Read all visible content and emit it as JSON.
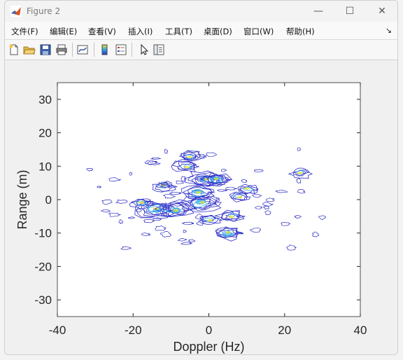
{
  "window": {
    "title": "Figure 2"
  },
  "window_controls": {
    "minimize": "—",
    "maximize": "☐",
    "close": "✕"
  },
  "menu": {
    "items": [
      {
        "label": "文件(F)"
      },
      {
        "label": "编辑(E)"
      },
      {
        "label": "查看(V)"
      },
      {
        "label": "插入(I)"
      },
      {
        "label": "工具(T)"
      },
      {
        "label": "桌面(D)"
      },
      {
        "label": "窗口(W)"
      },
      {
        "label": "帮助(H)"
      }
    ],
    "overflow_icon": "arrow-icon"
  },
  "toolbar": {
    "buttons": [
      "new-figure-icon",
      "open-file-icon",
      "save-icon",
      "print-icon",
      "link-plot-icon",
      "colorbar-icon",
      "legend-icon",
      "pointer-icon",
      "property-inspector-icon"
    ]
  },
  "chart_data": {
    "type": "contour",
    "xlabel": "Doppler (Hz)",
    "ylabel": "Range (m)",
    "xlim": [
      -40,
      40
    ],
    "ylim": [
      -35,
      35
    ],
    "xticks": [
      "-40",
      "-20",
      "0",
      "20",
      "40"
    ],
    "yticks": [
      "30",
      "20",
      "10",
      "0",
      "-10",
      "-20",
      "-30"
    ],
    "colormap": [
      "#3030c8",
      "#2aa7e8",
      "#f0e030"
    ],
    "peaks": [
      {
        "x": -14,
        "y": -3,
        "level": 0.95
      },
      {
        "x": -9,
        "y": -3,
        "level": 0.85
      },
      {
        "x": -2,
        "y": -1,
        "level": 0.9
      },
      {
        "x": -1,
        "y": 6,
        "level": 0.8
      },
      {
        "x": -3,
        "y": 2,
        "level": 0.7
      },
      {
        "x": 2,
        "y": 6,
        "level": 0.6
      },
      {
        "x": -6,
        "y": 10,
        "level": 0.55
      },
      {
        "x": 5,
        "y": -10,
        "level": 0.6
      },
      {
        "x": 6,
        "y": -5,
        "level": 0.5
      },
      {
        "x": -5,
        "y": 13,
        "level": 0.45
      },
      {
        "x": 10,
        "y": 3,
        "level": 0.4
      },
      {
        "x": -18,
        "y": -1,
        "level": 0.4
      },
      {
        "x": 24,
        "y": 8,
        "level": 0.35
      },
      {
        "x": 0,
        "y": -6,
        "level": 0.4
      },
      {
        "x": 8,
        "y": 1,
        "level": 0.35
      },
      {
        "x": -12,
        "y": 4,
        "level": 0.4
      }
    ]
  }
}
